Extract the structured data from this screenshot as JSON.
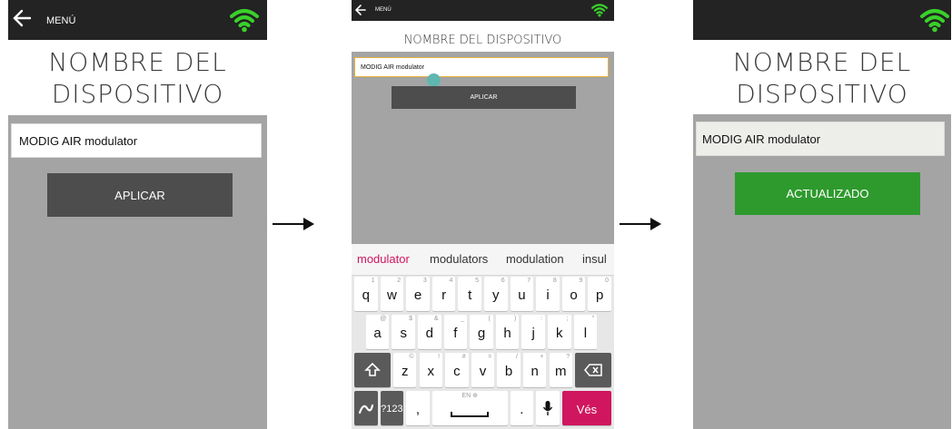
{
  "colors": {
    "topbar": "#232323",
    "panel_bg": "#a4a4a4",
    "apply_button": "#4d4d4d",
    "updated_button": "#2e9a2e",
    "wifi": "#39d12a",
    "accent_suggestion": "#d0165e",
    "field_focus": "#e8b23c"
  },
  "screen1": {
    "menu_label": "MENÚ",
    "title_line1": "NOMBRE DEL",
    "title_line2": "DISPOSITIVO",
    "device_name_value": "MODIG AIR modulator",
    "apply_label": "APLICAR"
  },
  "screen2": {
    "menu_label": "MENÚ",
    "title": "NOMBRE DEL DISPOSITIVO",
    "device_name_value": "MODIG AIR modulator",
    "apply_label": "APLICAR",
    "suggestions": [
      "modulator",
      "modulators",
      "modulation",
      "insul"
    ],
    "keyboard": {
      "row1": [
        {
          "k": "q",
          "s": "1"
        },
        {
          "k": "w",
          "s": "2"
        },
        {
          "k": "e",
          "s": "3"
        },
        {
          "k": "r",
          "s": "4"
        },
        {
          "k": "t",
          "s": "5"
        },
        {
          "k": "y",
          "s": "6"
        },
        {
          "k": "u",
          "s": "7"
        },
        {
          "k": "i",
          "s": "8"
        },
        {
          "k": "o",
          "s": "9"
        },
        {
          "k": "p",
          "s": "0"
        }
      ],
      "row2": [
        {
          "k": "a",
          "s": "@"
        },
        {
          "k": "s",
          "s": "$"
        },
        {
          "k": "d",
          "s": "&"
        },
        {
          "k": "f",
          "s": "_"
        },
        {
          "k": "g",
          "s": "("
        },
        {
          "k": "h",
          "s": ")"
        },
        {
          "k": "j",
          "s": ":"
        },
        {
          "k": "k",
          "s": ";"
        },
        {
          "k": "l",
          "s": "\""
        }
      ],
      "row3": [
        {
          "k": "z",
          "s": "©"
        },
        {
          "k": "x",
          "s": "!"
        },
        {
          "k": "c",
          "s": "#"
        },
        {
          "k": "v",
          "s": "="
        },
        {
          "k": "b",
          "s": "/"
        },
        {
          "k": "n",
          "s": "+"
        },
        {
          "k": "m",
          "s": "?"
        }
      ],
      "numbers_key": "?123",
      "comma_key": ",",
      "space_hint": "EN ⊕",
      "period_key": ".",
      "go_key": "Vés"
    }
  },
  "screen3": {
    "title_line1": "NOMBRE DEL",
    "title_line2": "DISPOSITIVO",
    "device_name_value": "MODIG AIR modulator",
    "updated_label": "ACTUALIZADO"
  }
}
